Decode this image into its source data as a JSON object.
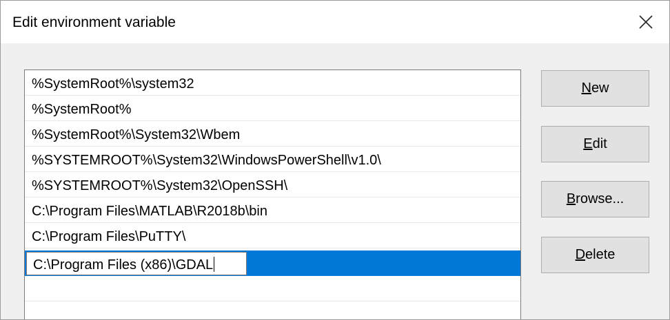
{
  "window": {
    "title": "Edit environment variable",
    "close_glyph": "close-icon"
  },
  "list": {
    "items": [
      "%SystemRoot%\\system32",
      "%SystemRoot%",
      "%SystemRoot%\\System32\\Wbem",
      "%SYSTEMROOT%\\System32\\WindowsPowerShell\\v1.0\\",
      "%SYSTEMROOT%\\System32\\OpenSSH\\",
      "C:\\Program Files\\MATLAB\\R2018b\\bin",
      "C:\\Program Files\\PuTTY\\"
    ],
    "editing_value": "C:\\Program Files (x86)\\GDAL",
    "selection_color": "#0078d7"
  },
  "buttons": {
    "new": {
      "access_key": "N",
      "rest": "ew"
    },
    "edit": {
      "access_key": "E",
      "rest": "dit"
    },
    "browse": {
      "access_key": "B",
      "rest": "rowse..."
    },
    "delete": {
      "access_key": "D",
      "rest": "elete"
    }
  }
}
